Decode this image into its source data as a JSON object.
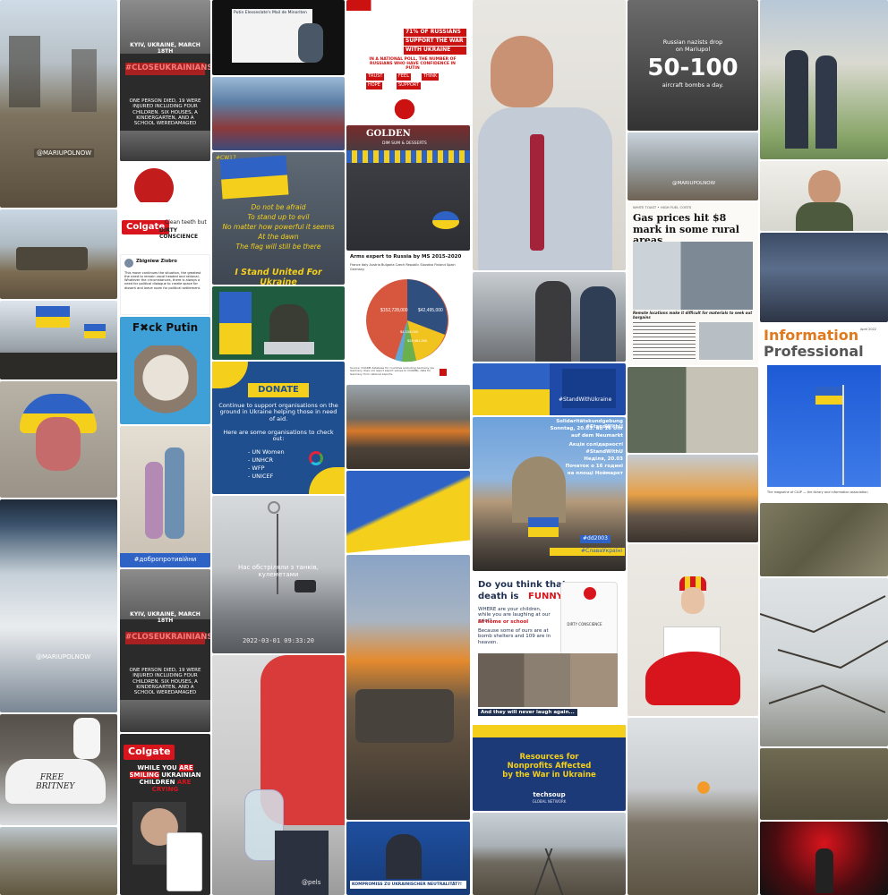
{
  "collage": {
    "c1": {
      "watermark_a": "@MARIUPOLNOW",
      "watermark_b": "@MARIUPOLNOW",
      "car_text": "FREE BRITNEY"
    },
    "c2": {
      "kyiv_caption_a": "KYIV, UKRAINE, MARCH 18TH",
      "hashtag_a": "#CLOSEUKRAINIANSKY",
      "report_a": "ONE PERSON DIED, 19 WERE INJURED INCLUDING FOUR CHILDREN. SIX HOUSES, A KINDERGARTEN, AND A SCHOOL WEREDAMAGED",
      "colgate_brand": "Colgate",
      "colgate_line1": "Clean teeth but",
      "colgate_line2": "DIRTY CONSCIENCE",
      "tweet_name": "Zbigniew Ziobro",
      "tweet_text": "This move continues the situation, the greatest the need to remain vocal headed and rational. Whatever the circumstances, there is always a need for political dialogue to create space for dissent and leave room for political settlement.",
      "fck_putin": "F✖ck Putin",
      "dobro_tag": "#добропротивійни",
      "kyiv_caption_b": "KYIV, UKRAINE, MARCH 18TH",
      "hashtag_b": "#CLOSEUKRAINIANSKY",
      "report_b": "ONE PERSON DIED, 19 WERE INJURED INCLUDING FOUR CHILDREN. SIX HOUSES, A KINDERGARTEN, AND A SCHOOL WEREDAMAGED",
      "colgate_brand_b": "Colgate",
      "smiling_text_1": "WHILE YOU",
      "smiling_text_2": "ARE SMILING",
      "smiling_text_3": "UKRAINIAN",
      "smiling_text_4": "CHILDREN",
      "smiling_text_5": "ARE CRYING"
    },
    "c3": {
      "tv_title": "Putin Elesseslate's Mail de Minoriten",
      "cw_tag": "#CW17",
      "poem_1": "Do not be afraid",
      "poem_2": "To stand up to evil",
      "poem_3": "No matter how powerful it seems",
      "poem_4": "At the dawn",
      "poem_5": "The flag will still be there",
      "stand_united": "I Stand United For Ukraine",
      "donate_heading": "DONATE",
      "donate_body": "Continue to support organisations on the ground in Ukraine helping those in need of aid.",
      "donate_intro": "Here are some organisations to check out:",
      "orgs": [
        "- UN Women",
        "- UNHCR",
        "- WFP",
        "- UNICEF"
      ],
      "shelling_text": "Нас обстріляли з танків, кулеметами",
      "dashcam_time": "2022-03-01  09:33:20",
      "watermark": "@pels"
    },
    "c4": {
      "poll_1": "71% OF RUSSIANS",
      "poll_2": "SUPPORT THE WAR",
      "poll_3": "WITH UKRAINE",
      "poll_4": "IN A NATIONAL POLL, THE NUMBER OF RUSSIANS WHO HAVE CONFIDENCE IN PUTIN",
      "poll_words": [
        "TRUST",
        "FEEL",
        "THINK",
        "HOPE",
        "SUPPORT"
      ],
      "shop_sign": "GOLDEN",
      "shop_sub": "DIM SUM & DESSERTS",
      "pie_title": "Arms expert to Russia by MS 2015-2020",
      "pie_legend": [
        "France",
        "Italy",
        "Austria",
        "Bulgaria",
        "Czech Republic",
        "Slovakia",
        "Finland",
        "Spain",
        "Germany"
      ],
      "pie_labels": [
        "$152,728,000",
        "$42,495,000",
        "$4,338,000",
        "$39,981,000"
      ],
      "pie_source": "Source: COARM database for countries excluding Germany (as Germany does not report export values to COARM); data for Germany from national exports.",
      "war_caption": "KOMPROMISS ZU UKRAINISCHER NEUTRALITÄT?!"
    },
    "c5": {
      "stand_tag": "#StandWithUkraine",
      "rally_1": "Solidaritätskundgebung #StandWithU",
      "rally_2": "Sonntag, 20.03. ab 16 Uhr",
      "rally_3": "auf dem Neumarkt",
      "rally_4": "Акція солідарності",
      "rally_5": "#StandWithU",
      "rally_6": "Неділя, 20.03",
      "rally_7": "Початок о 16 годині",
      "rally_8": "на площі Ноймаркт",
      "rally_tag_1": "#dd2003",
      "rally_tag_2": "#СлаваУкраїні",
      "funny_1": "Do you think that",
      "funny_2": "death is",
      "funny_3": "FUNNY?!",
      "funny_body_1": "WHERE are your children, while you are laughing at our grief?",
      "funny_body_2": "At home or school",
      "funny_body_3": "Because some of ours are at bomb shelters and 109 are in heaven.",
      "funny_footer": "And they will never laugh again...",
      "dirty_label": "DIRTY CONSCIENCE",
      "techsoup_1": "Resources for",
      "techsoup_2": "Nonprofits Affected",
      "techsoup_3": "by the War in Ukraine",
      "techsoup_brand": "techsoup",
      "techsoup_sub": "GLOBAL NETWORK"
    },
    "c6": {
      "mariupol_1": "Russian nazists drop",
      "mariupol_2": "on Mariupol",
      "big_number": "50-100",
      "mariupol_3": "aircraft bombs a day.",
      "watermark": "@MARIUPOLNOW",
      "newspaper_kicker": "WHITE TOAST • HIGH FUEL COSTS",
      "newspaper_headline": "Gas prices hit $8 mark in some rural areas",
      "newspaper_sub": "Remote locations make it difficult for materials to seek out bargains"
    },
    "c7": {
      "mag_title_1": "Information",
      "mag_title_2": "Professional",
      "mag_date": "April 2022",
      "mag_footer": "The magazine of CILIP — the library and information association"
    }
  },
  "colors": {
    "ukraine_blue": "#2e63c5",
    "ukraine_yellow": "#f4cf1b",
    "colgate_red": "#d8141c",
    "donate_blue": "#1f4f8f",
    "mag_orange": "#e07a1f"
  }
}
